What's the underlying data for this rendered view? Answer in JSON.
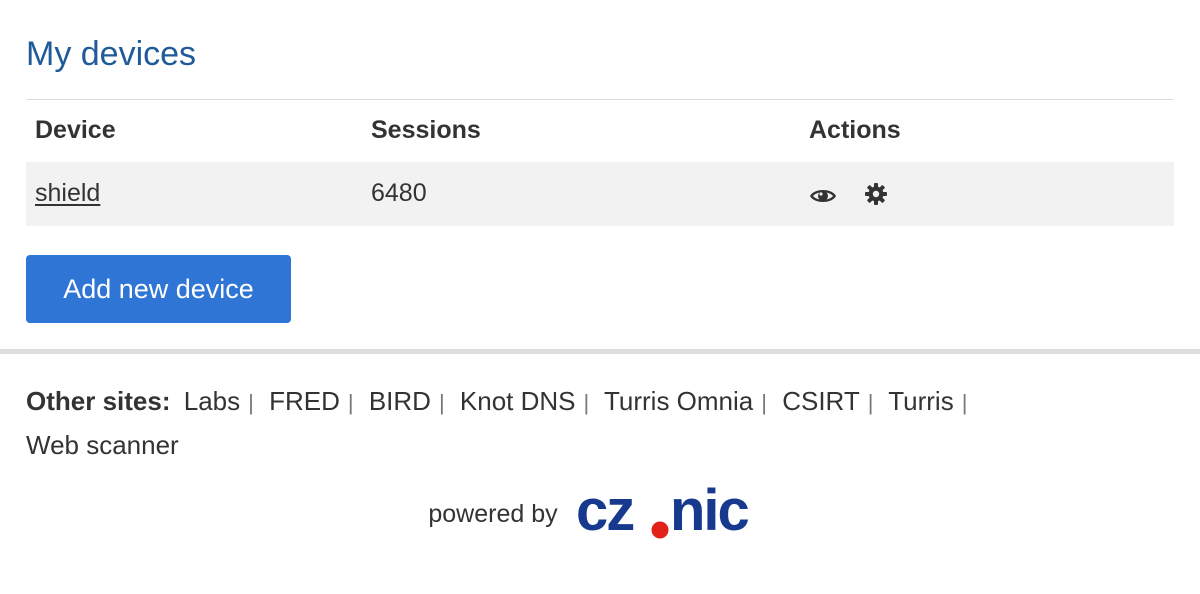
{
  "page": {
    "title": "My devices"
  },
  "table": {
    "headers": {
      "device": "Device",
      "sessions": "Sessions",
      "actions": "Actions"
    },
    "rows": [
      {
        "device": "shield",
        "sessions": "6480",
        "actions": [
          "eye-icon",
          "gear-icon"
        ]
      }
    ]
  },
  "add_button": {
    "label": "Add new device",
    "color": "#2f75d6"
  },
  "footer": {
    "other_sites_label": "Other sites:",
    "sites": [
      "Labs",
      "FRED",
      "BIRD",
      "Knot DNS",
      "Turris Omnia",
      "CSIRT",
      "Turris",
      "Web scanner"
    ],
    "powered_by": "powered by",
    "logo": {
      "text": "cz.nic",
      "color": "#173a8f",
      "dot_color": "#e32119"
    }
  },
  "colors": {
    "title": "#1f5a99",
    "row_background": "#f2f2f2"
  }
}
